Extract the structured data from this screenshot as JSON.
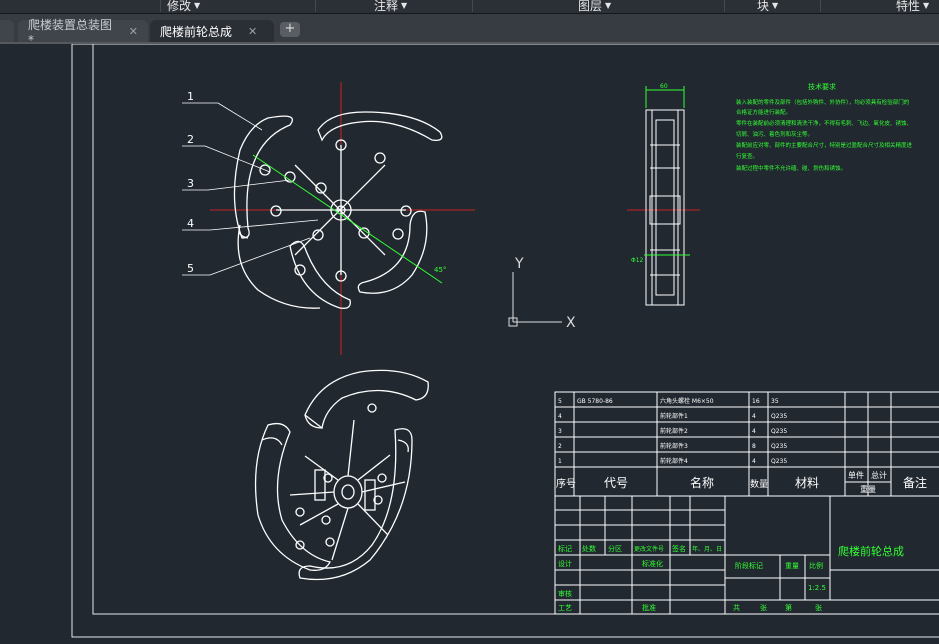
{
  "menubar": {
    "items": [
      {
        "label": "修改"
      },
      {
        "label": "注释"
      },
      {
        "label": "图层"
      },
      {
        "label": "块"
      },
      {
        "label": "特性"
      }
    ]
  },
  "tabs": [
    {
      "label": "爬楼装置总装图*",
      "active": false
    },
    {
      "label": "爬楼前轮总成",
      "active": true
    }
  ],
  "drawing": {
    "balloons": [
      "1",
      "2",
      "3",
      "4",
      "5"
    ],
    "ucs": {
      "x": "X",
      "y": "Y"
    },
    "tech_title": "技术要求",
    "tech_lines": [
      "装入装配的零件及部件（包括外购件、外协件），均必须具有检验部门的",
      "合格证方能进行装配。",
      "零件在装配前必须清理和清洗干净，不得有毛刺、飞边、氧化皮、锈蚀、",
      "切屑、油污、着色剂和灰尘等。",
      "装配前应对零、部件的主要配合尺寸，特别是过盈配合尺寸及相关精度进",
      "行复查。",
      "装配过程中零件不允许磕、碰、划伤和锈蚀。"
    ],
    "dim_side": "60",
    "dim_section": "Φ12",
    "dim_angle": "45°",
    "colors": {
      "line": "#ffffff",
      "center": "#ff2020",
      "dim": "#33ff33",
      "bg": "#212830"
    }
  },
  "title_block": {
    "parts": [
      {
        "no": "5",
        "code": "GB 5780-86",
        "name": "六角头螺栓 M6×50",
        "qty": "16",
        "material": "35"
      },
      {
        "no": "4",
        "code": "",
        "name": "前轮部件1",
        "qty": "4",
        "material": "Q235"
      },
      {
        "no": "3",
        "code": "",
        "name": "前轮部件2",
        "qty": "4",
        "material": "Q235"
      },
      {
        "no": "2",
        "code": "",
        "name": "前轮部件3",
        "qty": "8",
        "material": "Q235"
      },
      {
        "no": "1",
        "code": "",
        "name": "前轮部件4",
        "qty": "4",
        "material": "Q235"
      }
    ],
    "headers": {
      "no": "序号",
      "code": "代号",
      "name": "名称",
      "qty": "数量",
      "material": "材料",
      "single": "单件",
      "total": "总计",
      "weight": "重量",
      "remark": "备注"
    },
    "sign_labels": {
      "mark": "标记",
      "count": "处数",
      "zone": "分区",
      "doc": "更改文件号",
      "sign": "签名",
      "date": "年、月、日",
      "design": "设计",
      "standard": "标准化",
      "review": "审核",
      "process": "工艺",
      "approve": "批准"
    },
    "stage_labels": {
      "stage": "阶段标记",
      "weight": "重量",
      "scale": "比例"
    },
    "scale": "1:2.5",
    "sheet": {
      "total": "共",
      "zhang": "张",
      "page": "第",
      "zhang2": "张"
    },
    "drawing_name": "爬楼前轮总成"
  }
}
